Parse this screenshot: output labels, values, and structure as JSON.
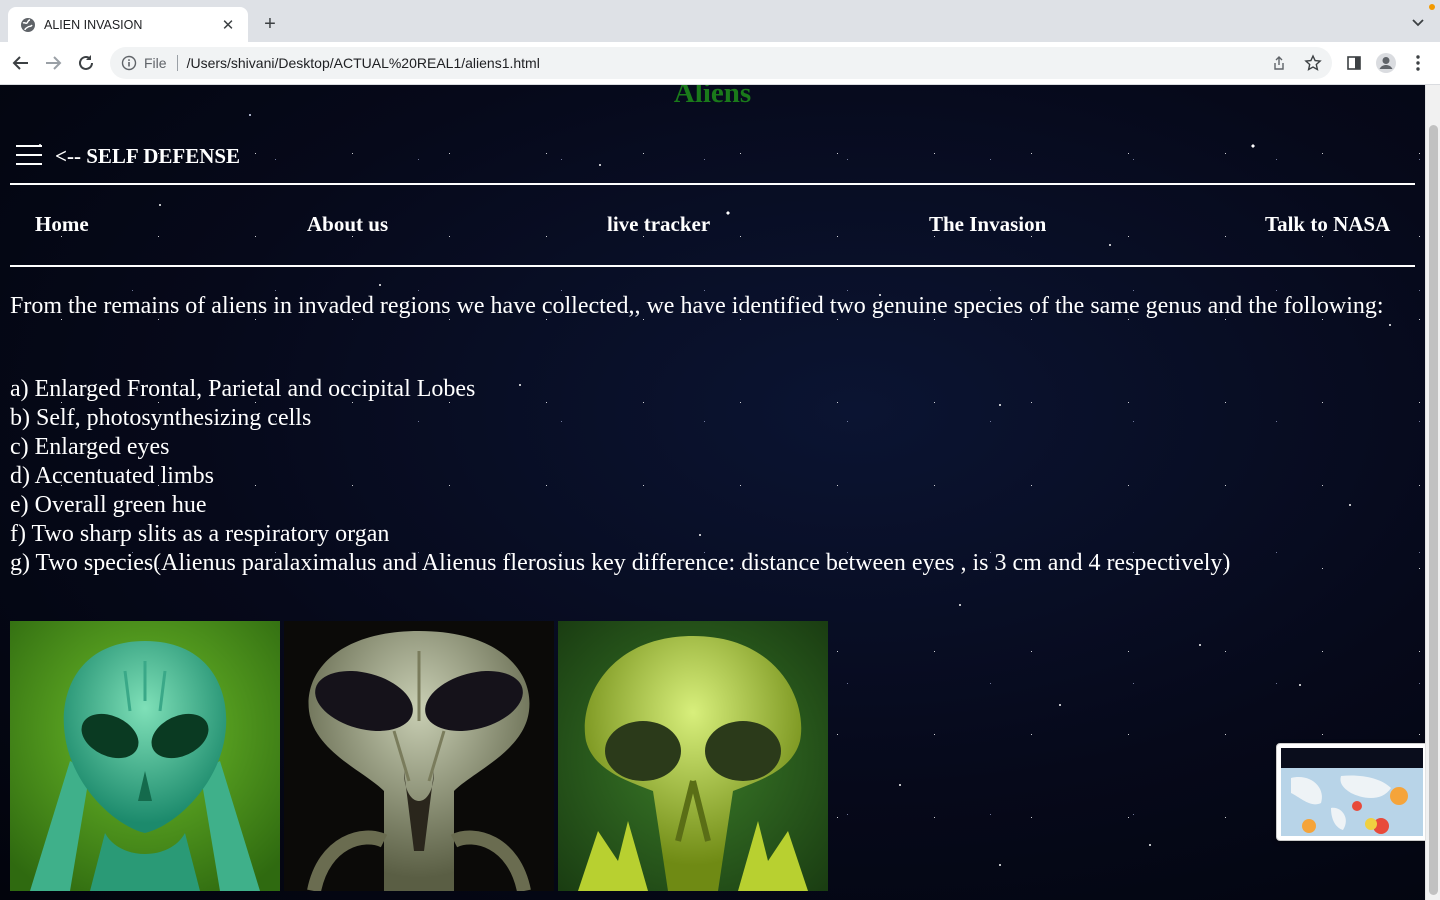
{
  "browser": {
    "tab_title": "ALIEN INVASION",
    "tab_favicon": "globe-icon",
    "scheme_label": "File",
    "url": "/Users/shivani/Desktop/ACTUAL%20REAL1/aliens1.html"
  },
  "page": {
    "site_title": "Aliens",
    "self_defense_link": "<-- SELF DEFENSE",
    "nav": [
      "Home",
      "About us",
      "live tracker",
      "The Invasion",
      "Talk to NASA"
    ],
    "intro": "From the remains of aliens in invaded regions we have collected,, we have identified two genuine species of the same genus and the following:",
    "traits": [
      "a) Enlarged Frontal, Parietal and occipital Lobes",
      "b) Self, photosynthesizing cells",
      "c) Enlarged eyes",
      "d) Accentuated limbs",
      "e) Overall green hue",
      "f) Two sharp slits as a respiratory organ",
      "g) Two species(Alienus paralaximalus and Alienus flerosius key difference: distance between eyes , is 3 cm and 4 respectively)"
    ],
    "colors": {
      "title_green": "#1a7a1a",
      "text": "#ffffff",
      "space_bg": "#06091a"
    }
  }
}
